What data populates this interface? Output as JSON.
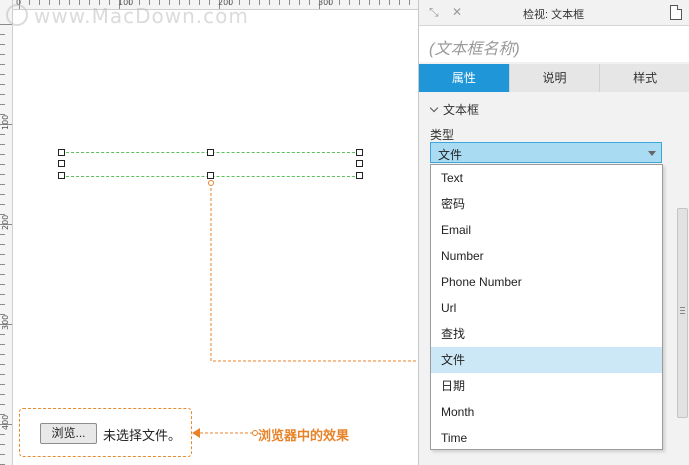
{
  "watermark": "www.MacDown.com",
  "ruler": {
    "top_labels": [
      "0",
      "100",
      "200",
      "300"
    ],
    "left_labels": [
      "100",
      "200",
      "300",
      "400"
    ]
  },
  "canvas": {
    "browse_button": "浏览...",
    "no_file_text": "未选择文件。",
    "effect_label": "浏览器中的效果",
    "accent_color": "#e8832a"
  },
  "panel": {
    "title": "检视: 文本框",
    "name_placeholder": "(文本框名称)",
    "tabs": [
      {
        "label": "属性",
        "active": true
      },
      {
        "label": "说明",
        "active": false
      },
      {
        "label": "样式",
        "active": false
      }
    ],
    "section": "文本框",
    "type_label": "类型",
    "type_value": "文件",
    "options": [
      "Text",
      "密码",
      "Email",
      "Number",
      "Phone Number",
      "Url",
      "查找",
      "文件",
      "日期",
      "Month",
      "Time"
    ],
    "selected_option": "文件",
    "accent_color": "#1e96d8"
  }
}
